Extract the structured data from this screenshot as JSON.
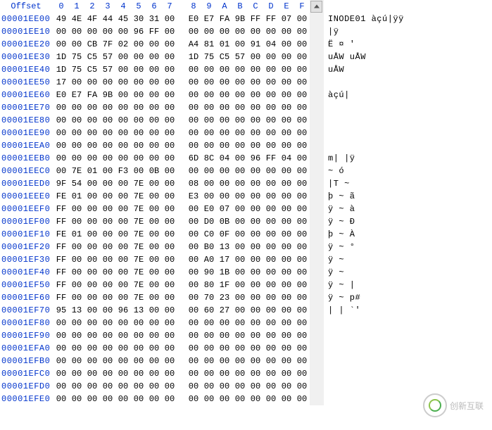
{
  "header": {
    "offset_label": "Offset",
    "columns": [
      "0",
      "1",
      "2",
      "3",
      "4",
      "5",
      "6",
      "7",
      "8",
      "9",
      "A",
      "B",
      "C",
      "D",
      "E",
      "F"
    ]
  },
  "rows": [
    {
      "offset": "00001EE00",
      "hex": [
        "49",
        "4E",
        "4F",
        "44",
        "45",
        "30",
        "31",
        "00",
        "E0",
        "E7",
        "FA",
        "9B",
        "FF",
        "FF",
        "07",
        "00"
      ],
      "ascii": "INODE01 àçú|ÿÿ"
    },
    {
      "offset": "00001EE10",
      "hex": [
        "00",
        "00",
        "00",
        "00",
        "00",
        "96",
        "FF",
        "00",
        "00",
        "00",
        "00",
        "00",
        "00",
        "00",
        "00",
        "00"
      ],
      "ascii": "          |ÿ"
    },
    {
      "offset": "00001EE20",
      "hex": [
        "00",
        "00",
        "CB",
        "7F",
        "02",
        "00",
        "00",
        "00",
        "A4",
        "81",
        "01",
        "00",
        "91",
        "04",
        "00",
        "00"
      ],
      "ascii": "  Ë     ¤   '"
    },
    {
      "offset": "00001EE30",
      "hex": [
        "1D",
        "75",
        "C5",
        "57",
        "00",
        "00",
        "00",
        "00",
        "1D",
        "75",
        "C5",
        "57",
        "00",
        "00",
        "00",
        "00"
      ],
      "ascii": " uÅW     uÅW"
    },
    {
      "offset": "00001EE40",
      "hex": [
        "1D",
        "75",
        "C5",
        "57",
        "00",
        "00",
        "00",
        "00",
        "00",
        "00",
        "00",
        "00",
        "00",
        "00",
        "00",
        "00"
      ],
      "ascii": " uÅW"
    },
    {
      "offset": "00001EE50",
      "hex": [
        "17",
        "00",
        "00",
        "00",
        "00",
        "00",
        "00",
        "00",
        "00",
        "00",
        "00",
        "00",
        "00",
        "00",
        "00",
        "00"
      ],
      "ascii": ""
    },
    {
      "offset": "00001EE60",
      "hex": [
        "E0",
        "E7",
        "FA",
        "9B",
        "00",
        "00",
        "00",
        "00",
        "00",
        "00",
        "00",
        "00",
        "00",
        "00",
        "00",
        "00"
      ],
      "ascii": "àçú|"
    },
    {
      "offset": "00001EE70",
      "hex": [
        "00",
        "00",
        "00",
        "00",
        "00",
        "00",
        "00",
        "00",
        "00",
        "00",
        "00",
        "00",
        "00",
        "00",
        "00",
        "00"
      ],
      "ascii": ""
    },
    {
      "offset": "00001EE80",
      "hex": [
        "00",
        "00",
        "00",
        "00",
        "00",
        "00",
        "00",
        "00",
        "00",
        "00",
        "00",
        "00",
        "00",
        "00",
        "00",
        "00"
      ],
      "ascii": ""
    },
    {
      "offset": "00001EE90",
      "hex": [
        "00",
        "00",
        "00",
        "00",
        "00",
        "00",
        "00",
        "00",
        "00",
        "00",
        "00",
        "00",
        "00",
        "00",
        "00",
        "00"
      ],
      "ascii": ""
    },
    {
      "offset": "00001EEA0",
      "hex": [
        "00",
        "00",
        "00",
        "00",
        "00",
        "00",
        "00",
        "00",
        "00",
        "00",
        "00",
        "00",
        "00",
        "00",
        "00",
        "00"
      ],
      "ascii": ""
    },
    {
      "offset": "00001EEB0",
      "hex": [
        "00",
        "00",
        "00",
        "00",
        "00",
        "00",
        "00",
        "00",
        "6D",
        "8C",
        "04",
        "00",
        "96",
        "FF",
        "04",
        "00"
      ],
      "ascii": "        m|   |ÿ"
    },
    {
      "offset": "00001EEC0",
      "hex": [
        "00",
        "7E",
        "01",
        "00",
        "F3",
        "00",
        "0B",
        "00",
        "00",
        "00",
        "00",
        "00",
        "00",
        "00",
        "00",
        "00"
      ],
      "ascii": " ~   ó"
    },
    {
      "offset": "00001EED0",
      "hex": [
        "9F",
        "54",
        "00",
        "00",
        "00",
        "7E",
        "00",
        "00",
        "08",
        "00",
        "00",
        "00",
        "00",
        "00",
        "00",
        "00"
      ],
      "ascii": "|T    ~"
    },
    {
      "offset": "00001EEE0",
      "hex": [
        "FE",
        "01",
        "00",
        "00",
        "00",
        "7E",
        "00",
        "00",
        "E3",
        "00",
        "00",
        "00",
        "00",
        "00",
        "00",
        "00"
      ],
      "ascii": "þ     ~  ã"
    },
    {
      "offset": "00001EEF0",
      "hex": [
        "FF",
        "00",
        "00",
        "00",
        "00",
        "7E",
        "00",
        "00",
        "00",
        "E0",
        "07",
        "00",
        "00",
        "00",
        "00",
        "00"
      ],
      "ascii": "ÿ     ~  à"
    },
    {
      "offset": "00001EF00",
      "hex": [
        "FF",
        "00",
        "00",
        "00",
        "00",
        "7E",
        "00",
        "00",
        "00",
        "D0",
        "0B",
        "00",
        "00",
        "00",
        "00",
        "00"
      ],
      "ascii": "ÿ     ~  Ð"
    },
    {
      "offset": "00001EF10",
      "hex": [
        "FE",
        "01",
        "00",
        "00",
        "00",
        "7E",
        "00",
        "00",
        "00",
        "C0",
        "0F",
        "00",
        "00",
        "00",
        "00",
        "00"
      ],
      "ascii": "þ     ~  À"
    },
    {
      "offset": "00001EF20",
      "hex": [
        "FF",
        "00",
        "00",
        "00",
        "00",
        "7E",
        "00",
        "00",
        "00",
        "B0",
        "13",
        "00",
        "00",
        "00",
        "00",
        "00"
      ],
      "ascii": "ÿ     ~  °"
    },
    {
      "offset": "00001EF30",
      "hex": [
        "FF",
        "00",
        "00",
        "00",
        "00",
        "7E",
        "00",
        "00",
        "00",
        "A0",
        "17",
        "00",
        "00",
        "00",
        "00",
        "00"
      ],
      "ascii": "ÿ     ~"
    },
    {
      "offset": "00001EF40",
      "hex": [
        "FF",
        "00",
        "00",
        "00",
        "00",
        "7E",
        "00",
        "00",
        "00",
        "90",
        "1B",
        "00",
        "00",
        "00",
        "00",
        "00"
      ],
      "ascii": "ÿ     ~"
    },
    {
      "offset": "00001EF50",
      "hex": [
        "FF",
        "00",
        "00",
        "00",
        "00",
        "7E",
        "00",
        "00",
        "00",
        "80",
        "1F",
        "00",
        "00",
        "00",
        "00",
        "00"
      ],
      "ascii": "ÿ     ~  |"
    },
    {
      "offset": "00001EF60",
      "hex": [
        "FF",
        "00",
        "00",
        "00",
        "00",
        "7E",
        "00",
        "00",
        "00",
        "70",
        "23",
        "00",
        "00",
        "00",
        "00",
        "00"
      ],
      "ascii": "ÿ     ~  p#"
    },
    {
      "offset": "00001EF70",
      "hex": [
        "95",
        "13",
        "00",
        "00",
        "96",
        "13",
        "00",
        "00",
        "00",
        "60",
        "27",
        "00",
        "00",
        "00",
        "00",
        "00"
      ],
      "ascii": "|    |    `'"
    },
    {
      "offset": "00001EF80",
      "hex": [
        "00",
        "00",
        "00",
        "00",
        "00",
        "00",
        "00",
        "00",
        "00",
        "00",
        "00",
        "00",
        "00",
        "00",
        "00",
        "00"
      ],
      "ascii": ""
    },
    {
      "offset": "00001EF90",
      "hex": [
        "00",
        "00",
        "00",
        "00",
        "00",
        "00",
        "00",
        "00",
        "00",
        "00",
        "00",
        "00",
        "00",
        "00",
        "00",
        "00"
      ],
      "ascii": ""
    },
    {
      "offset": "00001EFA0",
      "hex": [
        "00",
        "00",
        "00",
        "00",
        "00",
        "00",
        "00",
        "00",
        "00",
        "00",
        "00",
        "00",
        "00",
        "00",
        "00",
        "00"
      ],
      "ascii": ""
    },
    {
      "offset": "00001EFB0",
      "hex": [
        "00",
        "00",
        "00",
        "00",
        "00",
        "00",
        "00",
        "00",
        "00",
        "00",
        "00",
        "00",
        "00",
        "00",
        "00",
        "00"
      ],
      "ascii": ""
    },
    {
      "offset": "00001EFC0",
      "hex": [
        "00",
        "00",
        "00",
        "00",
        "00",
        "00",
        "00",
        "00",
        "00",
        "00",
        "00",
        "00",
        "00",
        "00",
        "00",
        "00"
      ],
      "ascii": ""
    },
    {
      "offset": "00001EFD0",
      "hex": [
        "00",
        "00",
        "00",
        "00",
        "00",
        "00",
        "00",
        "00",
        "00",
        "00",
        "00",
        "00",
        "00",
        "00",
        "00",
        "00"
      ],
      "ascii": ""
    },
    {
      "offset": "00001EFE0",
      "hex": [
        "00",
        "00",
        "00",
        "00",
        "00",
        "00",
        "00",
        "00",
        "00",
        "00",
        "00",
        "00",
        "00",
        "00",
        "00",
        "00"
      ],
      "ascii": ""
    }
  ],
  "watermark": {
    "text": "创新互联"
  }
}
